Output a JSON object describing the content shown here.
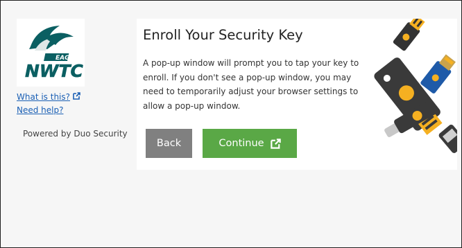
{
  "sidebar": {
    "logo": {
      "upper_text": "EAGLES",
      "lower_text": "NWTC"
    },
    "links": {
      "what_is_this": "What is this?",
      "need_help": "Need help?"
    },
    "powered_by": "Powered by Duo Security"
  },
  "card": {
    "title": "Enroll Your Security Key",
    "description": "A pop-up window will prompt you to tap your key to enroll. If you don't see a pop-up window, you may need to temporarily adjust your browser settings to allow a pop-up window.",
    "buttons": {
      "back": "Back",
      "continue": "Continue"
    }
  },
  "colors": {
    "link": "#1a5fb4",
    "back_button": "#808080",
    "continue_button": "#5aa846",
    "logo_teal": "#0b5f62",
    "key_yellow": "#f5b021",
    "key_blue": "#1e5aa8",
    "key_dark": "#333333"
  },
  "icons": {
    "external_link": "external-link-icon",
    "illustration": "security-keys-illustration"
  }
}
